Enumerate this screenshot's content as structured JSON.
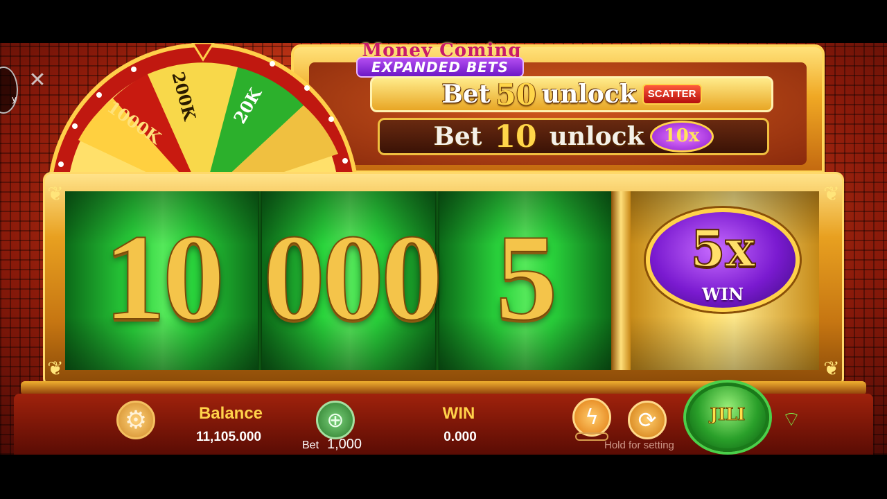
{
  "game": {
    "logo_text": "Money Coming",
    "expanded_bets_label": "EXPANDED BETS",
    "unlock_rows": [
      {
        "prefix": "Bet",
        "amount": "50",
        "suffix": "unlock",
        "badge": "SCATTER"
      },
      {
        "prefix": "Bet",
        "amount": "10",
        "suffix": "unlock",
        "badge": "10x"
      }
    ],
    "wheel_segments": [
      "1000K",
      "200K",
      "20K"
    ],
    "reels": [
      "10",
      "000",
      "5"
    ],
    "bonus_reel": {
      "multiplier": "5x",
      "label": "WIN"
    },
    "colors": {
      "reel_green": "#2ad43c",
      "gold": "#ffd24a",
      "bonus_purple": "#7a1ad0",
      "background_red": "#d8421c"
    }
  },
  "controls": {
    "settings_icon": "gear-icon",
    "balance_label": "Balance",
    "balance_value": "11,105.000",
    "bet_label": "Bet",
    "bet_value": "1,000",
    "win_label": "WIN",
    "win_value": "0.000",
    "turbo_icon": "lightning-icon",
    "autoplay_icon": "autoplay-icon",
    "hold_hint": "Hold for setting",
    "spin_label": "JILI",
    "wifi_icon": "wifi-icon"
  },
  "overlay": {
    "editor_icon": "capcut-icon",
    "left_fragment": "y"
  }
}
